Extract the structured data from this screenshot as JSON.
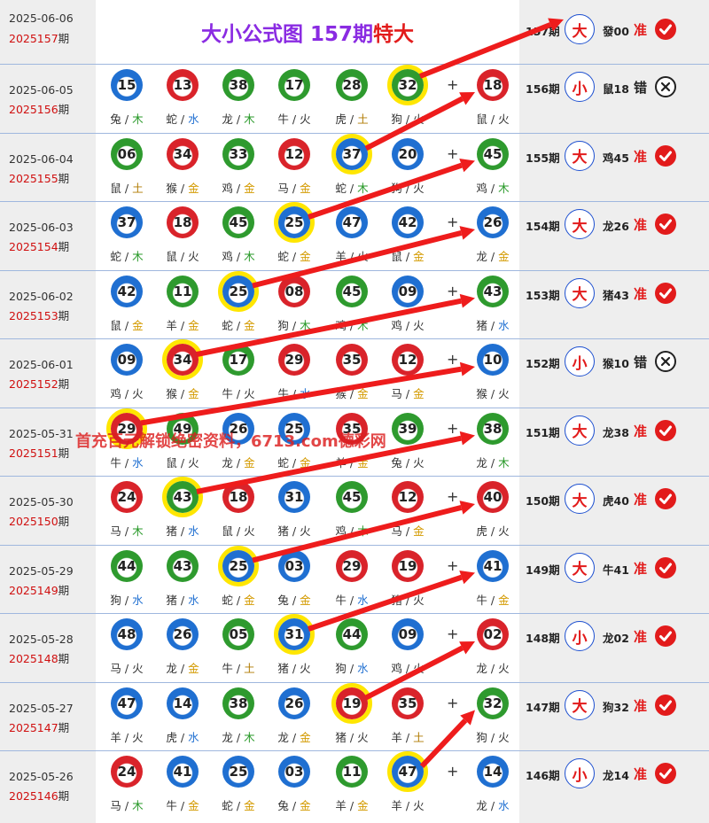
{
  "title": {
    "main": "大小公式图 157期",
    "highlight": "特大"
  },
  "watermark": "首充百元解锁绝密资料，6713.com德彩网",
  "header_row": {
    "date": "2025-06-06",
    "issue": "2025157",
    "issue_suffix": "期",
    "result": {
      "label": "157期",
      "size": "大",
      "text": "發00",
      "verdict": "准",
      "correct": true
    }
  },
  "rows": [
    {
      "date": "2025-06-05",
      "issue": "2025156",
      "balls": [
        {
          "n": "15",
          "c": "blue",
          "z": "兔",
          "e": "木"
        },
        {
          "n": "13",
          "c": "red",
          "z": "蛇",
          "e": "水"
        },
        {
          "n": "38",
          "c": "green",
          "z": "龙",
          "e": "木"
        },
        {
          "n": "17",
          "c": "green",
          "z": "牛",
          "e": "火"
        },
        {
          "n": "28",
          "c": "green",
          "z": "虎",
          "e": "土"
        },
        {
          "n": "32",
          "c": "green",
          "z": "狗",
          "e": "火"
        }
      ],
      "special": {
        "n": "18",
        "c": "red",
        "z": "鼠",
        "e": "火"
      },
      "hl": 5,
      "result": {
        "label": "156期",
        "size": "小",
        "text": "鼠18",
        "verdict": "错",
        "correct": false
      }
    },
    {
      "date": "2025-06-04",
      "issue": "2025155",
      "balls": [
        {
          "n": "06",
          "c": "green",
          "z": "鼠",
          "e": "土"
        },
        {
          "n": "34",
          "c": "red",
          "z": "猴",
          "e": "金"
        },
        {
          "n": "33",
          "c": "green",
          "z": "鸡",
          "e": "金"
        },
        {
          "n": "12",
          "c": "red",
          "z": "马",
          "e": "金"
        },
        {
          "n": "37",
          "c": "blue",
          "z": "蛇",
          "e": "木"
        },
        {
          "n": "20",
          "c": "blue",
          "z": "狗",
          "e": "火"
        }
      ],
      "special": {
        "n": "45",
        "c": "green",
        "z": "鸡",
        "e": "木"
      },
      "hl": 4,
      "result": {
        "label": "155期",
        "size": "大",
        "text": "鸡45",
        "verdict": "准",
        "correct": true
      }
    },
    {
      "date": "2025-06-03",
      "issue": "2025154",
      "balls": [
        {
          "n": "37",
          "c": "blue",
          "z": "蛇",
          "e": "木"
        },
        {
          "n": "18",
          "c": "red",
          "z": "鼠",
          "e": "火"
        },
        {
          "n": "45",
          "c": "green",
          "z": "鸡",
          "e": "木"
        },
        {
          "n": "25",
          "c": "blue",
          "z": "蛇",
          "e": "金"
        },
        {
          "n": "47",
          "c": "blue",
          "z": "羊",
          "e": "火"
        },
        {
          "n": "42",
          "c": "blue",
          "z": "鼠",
          "e": "金"
        }
      ],
      "special": {
        "n": "26",
        "c": "blue",
        "z": "龙",
        "e": "金"
      },
      "hl": 3,
      "result": {
        "label": "154期",
        "size": "大",
        "text": "龙26",
        "verdict": "准",
        "correct": true
      }
    },
    {
      "date": "2025-06-02",
      "issue": "2025153",
      "balls": [
        {
          "n": "42",
          "c": "blue",
          "z": "鼠",
          "e": "金"
        },
        {
          "n": "11",
          "c": "green",
          "z": "羊",
          "e": "金"
        },
        {
          "n": "25",
          "c": "blue",
          "z": "蛇",
          "e": "金"
        },
        {
          "n": "08",
          "c": "red",
          "z": "狗",
          "e": "木"
        },
        {
          "n": "45",
          "c": "green",
          "z": "鸡",
          "e": "木"
        },
        {
          "n": "09",
          "c": "blue",
          "z": "鸡",
          "e": "火"
        }
      ],
      "special": {
        "n": "43",
        "c": "green",
        "z": "猪",
        "e": "水"
      },
      "hl": 2,
      "result": {
        "label": "153期",
        "size": "大",
        "text": "猪43",
        "verdict": "准",
        "correct": true
      }
    },
    {
      "date": "2025-06-01",
      "issue": "2025152",
      "balls": [
        {
          "n": "09",
          "c": "blue",
          "z": "鸡",
          "e": "火"
        },
        {
          "n": "34",
          "c": "red",
          "z": "猴",
          "e": "金"
        },
        {
          "n": "17",
          "c": "green",
          "z": "牛",
          "e": "火"
        },
        {
          "n": "29",
          "c": "red",
          "z": "牛",
          "e": "水"
        },
        {
          "n": "35",
          "c": "red",
          "z": "猴",
          "e": "金"
        },
        {
          "n": "12",
          "c": "red",
          "z": "马",
          "e": "金"
        }
      ],
      "special": {
        "n": "10",
        "c": "blue",
        "z": "猴",
        "e": "火"
      },
      "hl": 1,
      "result": {
        "label": "152期",
        "size": "小",
        "text": "猴10",
        "verdict": "错",
        "correct": false
      }
    },
    {
      "date": "2025-05-31",
      "issue": "2025151",
      "balls": [
        {
          "n": "29",
          "c": "red",
          "z": "牛",
          "e": "水"
        },
        {
          "n": "49",
          "c": "green",
          "z": "鼠",
          "e": "火"
        },
        {
          "n": "26",
          "c": "blue",
          "z": "龙",
          "e": "金"
        },
        {
          "n": "25",
          "c": "blue",
          "z": "蛇",
          "e": "金"
        },
        {
          "n": "35",
          "c": "red",
          "z": "羊",
          "e": "金"
        },
        {
          "n": "39",
          "c": "green",
          "z": "兔",
          "e": "火"
        }
      ],
      "special": {
        "n": "38",
        "c": "green",
        "z": "龙",
        "e": "木"
      },
      "hl": 0,
      "result": {
        "label": "151期",
        "size": "大",
        "text": "龙38",
        "verdict": "准",
        "correct": true
      }
    },
    {
      "date": "2025-05-30",
      "issue": "2025150",
      "balls": [
        {
          "n": "24",
          "c": "red",
          "z": "马",
          "e": "木"
        },
        {
          "n": "43",
          "c": "green",
          "z": "猪",
          "e": "水"
        },
        {
          "n": "18",
          "c": "red",
          "z": "鼠",
          "e": "火"
        },
        {
          "n": "31",
          "c": "blue",
          "z": "猪",
          "e": "火"
        },
        {
          "n": "45",
          "c": "green",
          "z": "鸡",
          "e": "木"
        },
        {
          "n": "12",
          "c": "red",
          "z": "马",
          "e": "金"
        }
      ],
      "special": {
        "n": "40",
        "c": "red",
        "z": "虎",
        "e": "火"
      },
      "hl": 1,
      "result": {
        "label": "150期",
        "size": "大",
        "text": "虎40",
        "verdict": "准",
        "correct": true
      }
    },
    {
      "date": "2025-05-29",
      "issue": "2025149",
      "balls": [
        {
          "n": "44",
          "c": "green",
          "z": "狗",
          "e": "水"
        },
        {
          "n": "43",
          "c": "green",
          "z": "猪",
          "e": "水"
        },
        {
          "n": "25",
          "c": "blue",
          "z": "蛇",
          "e": "金"
        },
        {
          "n": "03",
          "c": "blue",
          "z": "兔",
          "e": "金"
        },
        {
          "n": "29",
          "c": "red",
          "z": "牛",
          "e": "水"
        },
        {
          "n": "19",
          "c": "red",
          "z": "猪",
          "e": "火"
        }
      ],
      "special": {
        "n": "41",
        "c": "blue",
        "z": "牛",
        "e": "金"
      },
      "hl": 2,
      "result": {
        "label": "149期",
        "size": "大",
        "text": "牛41",
        "verdict": "准",
        "correct": true
      }
    },
    {
      "date": "2025-05-28",
      "issue": "2025148",
      "balls": [
        {
          "n": "48",
          "c": "blue",
          "z": "马",
          "e": "火"
        },
        {
          "n": "26",
          "c": "blue",
          "z": "龙",
          "e": "金"
        },
        {
          "n": "05",
          "c": "green",
          "z": "牛",
          "e": "土"
        },
        {
          "n": "31",
          "c": "blue",
          "z": "猪",
          "e": "火"
        },
        {
          "n": "44",
          "c": "green",
          "z": "狗",
          "e": "水"
        },
        {
          "n": "09",
          "c": "blue",
          "z": "鸡",
          "e": "火"
        }
      ],
      "special": {
        "n": "02",
        "c": "red",
        "z": "龙",
        "e": "火"
      },
      "hl": 3,
      "result": {
        "label": "148期",
        "size": "小",
        "text": "龙02",
        "verdict": "准",
        "correct": true
      }
    },
    {
      "date": "2025-05-27",
      "issue": "2025147",
      "balls": [
        {
          "n": "47",
          "c": "blue",
          "z": "羊",
          "e": "火"
        },
        {
          "n": "14",
          "c": "blue",
          "z": "虎",
          "e": "水"
        },
        {
          "n": "38",
          "c": "green",
          "z": "龙",
          "e": "木"
        },
        {
          "n": "26",
          "c": "blue",
          "z": "龙",
          "e": "金"
        },
        {
          "n": "19",
          "c": "red",
          "z": "猪",
          "e": "火"
        },
        {
          "n": "35",
          "c": "red",
          "z": "羊",
          "e": "土"
        }
      ],
      "special": {
        "n": "32",
        "c": "green",
        "z": "狗",
        "e": "火"
      },
      "hl": 4,
      "result": {
        "label": "147期",
        "size": "大",
        "text": "狗32",
        "verdict": "准",
        "correct": true
      }
    },
    {
      "date": "2025-05-26",
      "issue": "2025146",
      "balls": [
        {
          "n": "24",
          "c": "red",
          "z": "马",
          "e": "木"
        },
        {
          "n": "41",
          "c": "blue",
          "z": "牛",
          "e": "金"
        },
        {
          "n": "25",
          "c": "blue",
          "z": "蛇",
          "e": "金"
        },
        {
          "n": "03",
          "c": "blue",
          "z": "兔",
          "e": "金"
        },
        {
          "n": "11",
          "c": "green",
          "z": "羊",
          "e": "金"
        },
        {
          "n": "47",
          "c": "blue",
          "z": "羊",
          "e": "火"
        }
      ],
      "special": {
        "n": "14",
        "c": "blue",
        "z": "龙",
        "e": "水"
      },
      "hl": 5,
      "result": {
        "label": "146期",
        "size": "小",
        "text": "龙14",
        "verdict": "准",
        "correct": true
      }
    }
  ]
}
